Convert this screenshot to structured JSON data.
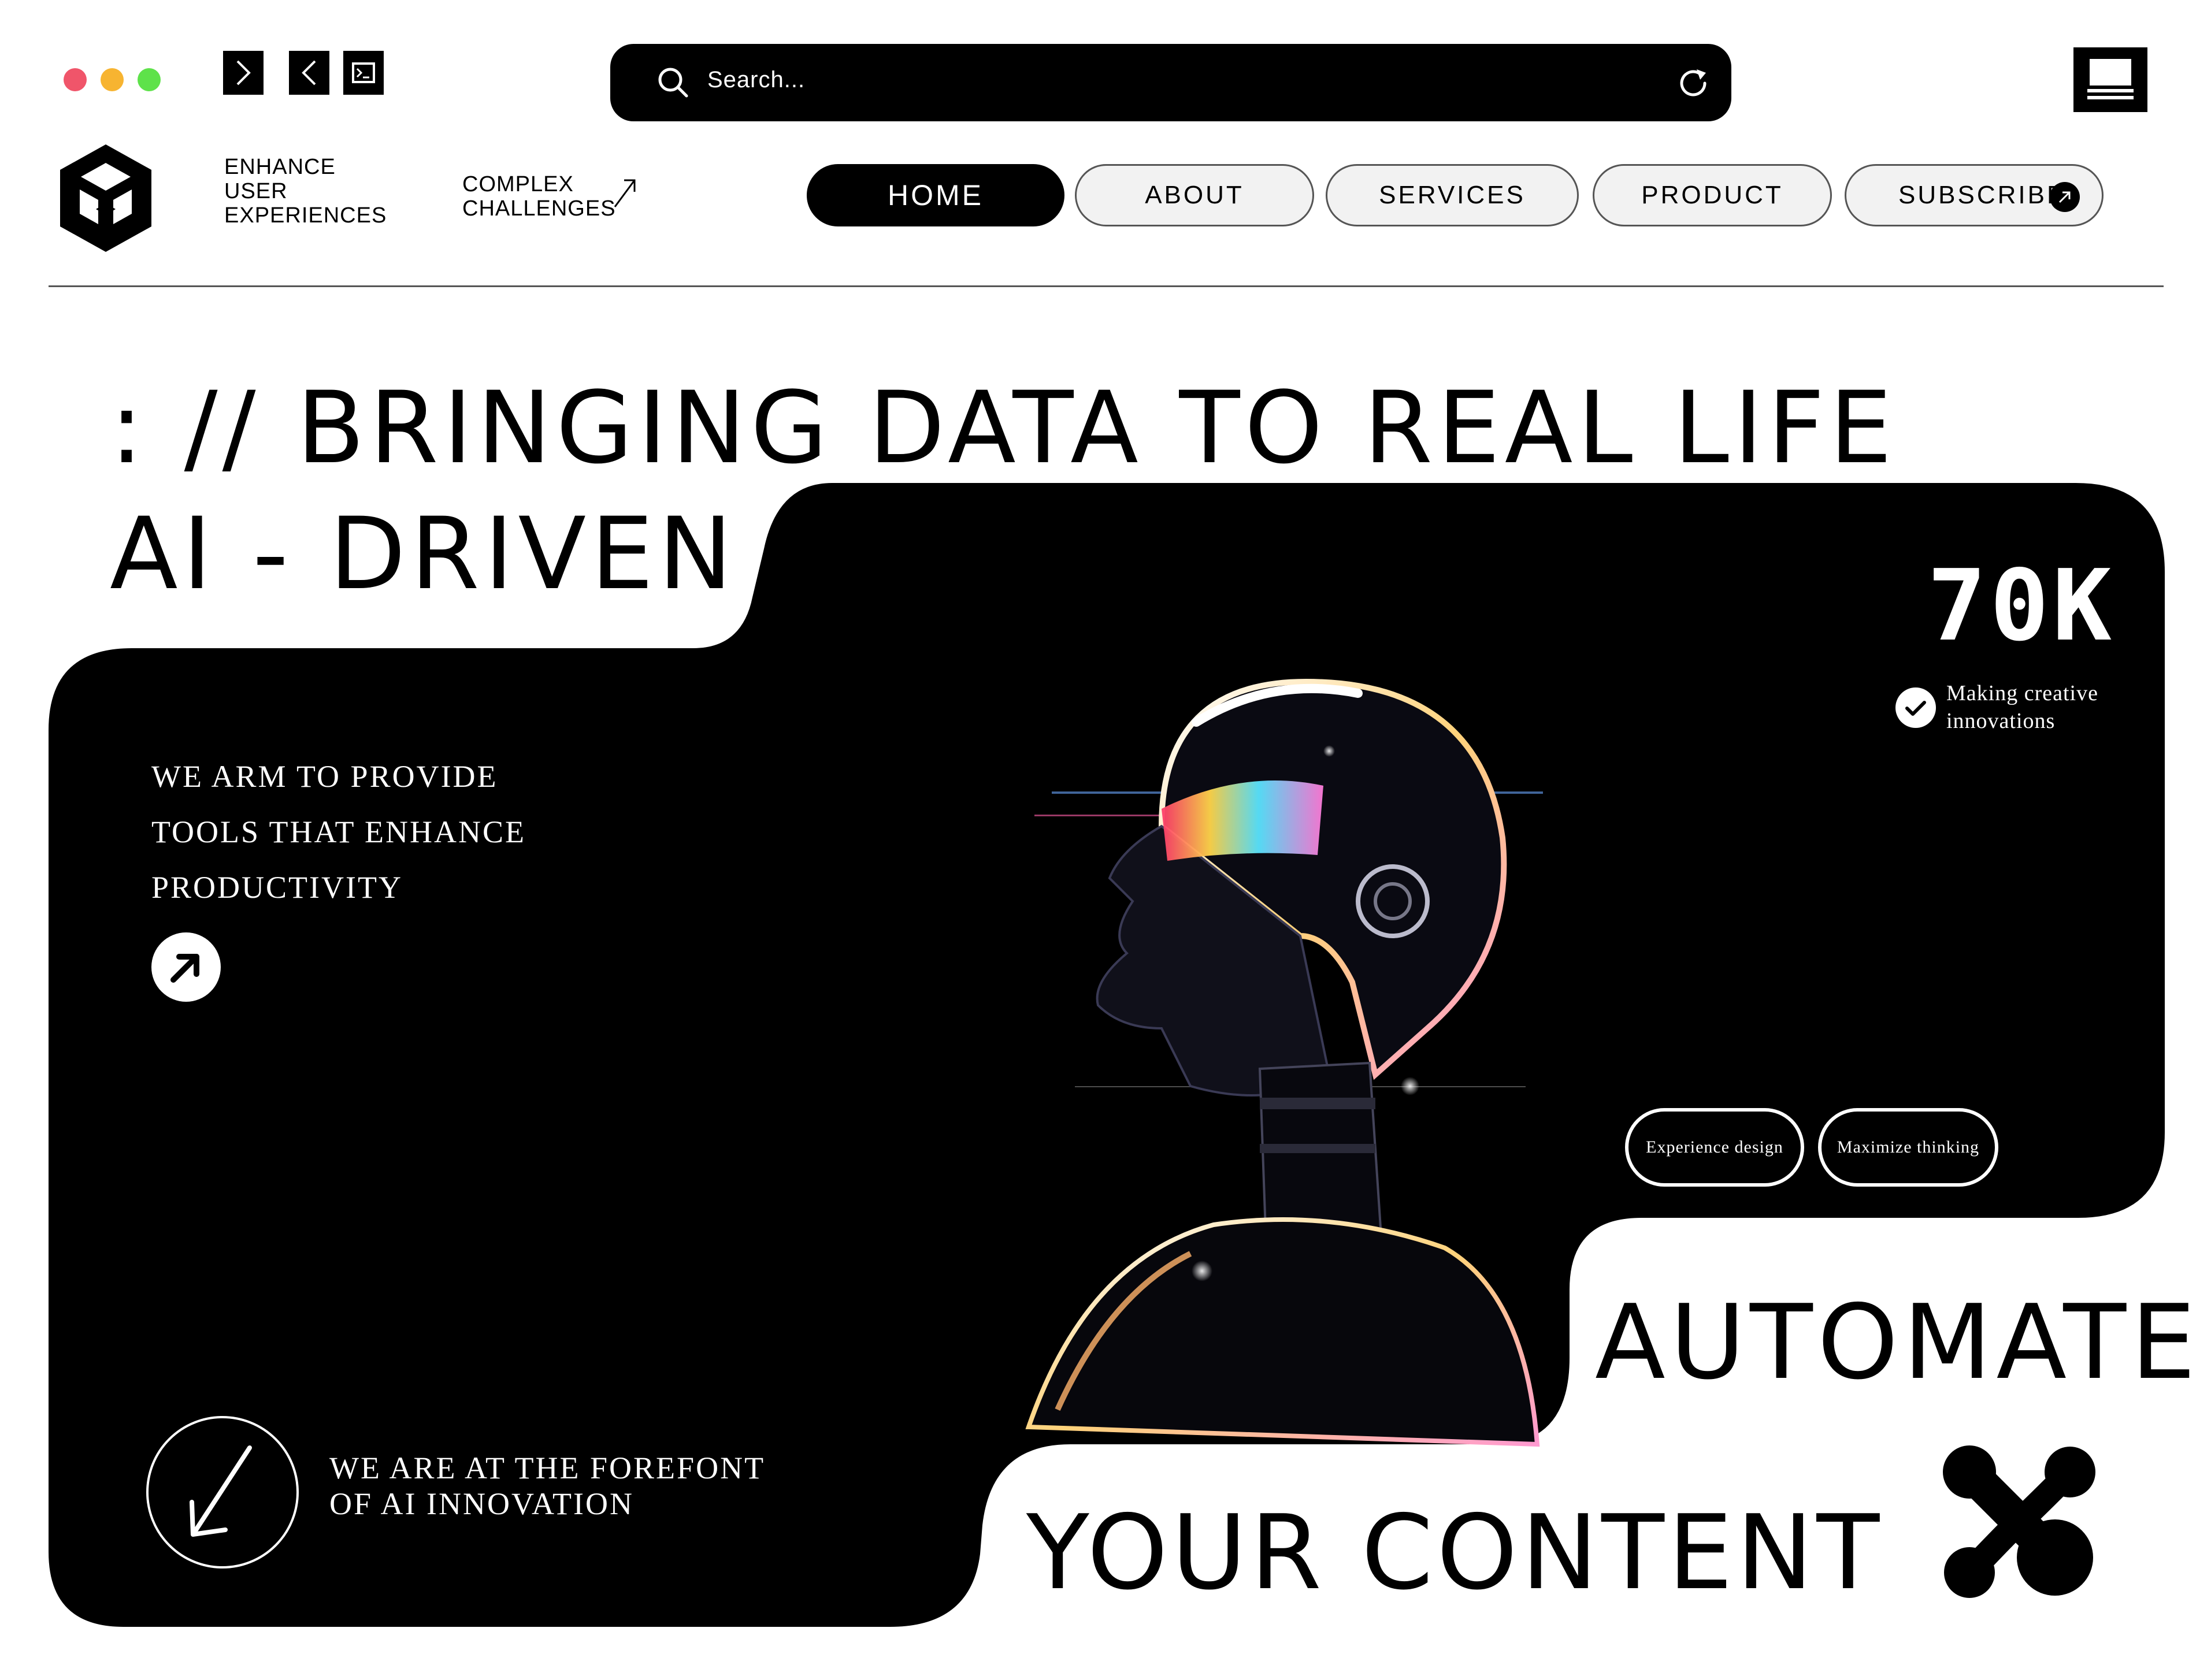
{
  "window": {
    "traffic_lights": [
      "#f0556a",
      "#f7b431",
      "#5ee24a"
    ],
    "toolbar_icons": [
      "forward-icon",
      "back-icon",
      "terminal-icon"
    ]
  },
  "search": {
    "placeholder": "Search...",
    "refresh_icon": "refresh-icon"
  },
  "header": {
    "tagline_1": [
      "ENHANCE",
      "USER",
      "EXPERIENCES"
    ],
    "tagline_2": [
      "COMPLEX",
      "CHALLENGES"
    ],
    "nav": [
      {
        "label": "HOME",
        "active": true
      },
      {
        "label": "ABOUT",
        "active": false
      },
      {
        "label": "SERVICES",
        "active": false
      },
      {
        "label": "PRODUCT",
        "active": false
      },
      {
        "label": "SUBSCRIBE",
        "active": false
      }
    ]
  },
  "hero": {
    "headline_1": ": // BRINGING DATA TO REAL LIFE",
    "headline_2": "AI - DRIVEN",
    "intro_lines": [
      "WE ARM TO PROVIDE",
      "TOOLS THAT ENHANCE",
      "PRODUCTIVITY"
    ],
    "stat_value": "70K",
    "stat_caption": [
      "Making creative",
      "innovations"
    ],
    "tags": [
      "Experience design",
      "Maximize thinking"
    ],
    "footer_lines": [
      "WE ARE AT THE FOREFONT",
      "OF AI INNOVATION"
    ],
    "tagline_3": "AUTOMATE",
    "tagline_4": "YOUR CONTENT"
  },
  "colors": {
    "accent": "#000000",
    "background": "#ffffff"
  }
}
